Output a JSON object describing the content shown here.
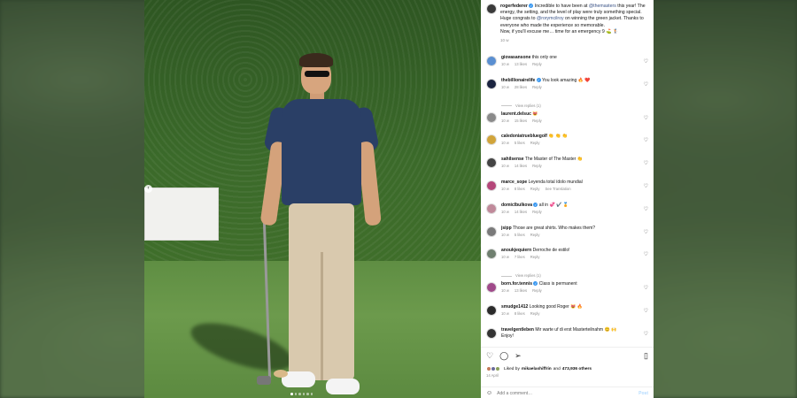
{
  "post": {
    "author": "rogerfederer",
    "caption_parts": {
      "p1": "Incredible to have been at ",
      "mention1": "@themasters",
      "p2": " this year! The energy, the setting, and the level of play were truly something special. Huge congrats to ",
      "mention2": "@rorymcilroy",
      "p3": " on winning the green jacket. Thanks to everyone who made the experience so memorable.",
      "p4": "Now, if you'll excuse me… time for an emergency 9 ⛳️ 🏌️"
    },
    "time": "10 w",
    "photo_dots": 6,
    "photo_active_dot": 0
  },
  "comments": [
    {
      "user": "giovasansone",
      "verified": false,
      "text": "this only one",
      "time": "10 w",
      "likes": "13 likes",
      "reply": "Reply",
      "avatar_color": "#5a8fd1"
    },
    {
      "user": "thebillionairelife",
      "verified": true,
      "text": "You look amazing 🔥 ❤️",
      "time": "10 w",
      "likes": "28 likes",
      "reply": "Reply",
      "avatar_color": "#1b2440",
      "replies": "View replies (1)"
    },
    {
      "user": "laurent.delsuc",
      "verified": false,
      "text": "😻",
      "time": "10 w",
      "likes": "15 likes",
      "reply": "Reply",
      "avatar_color": "#8a8a8a"
    },
    {
      "user": "caledoniatruebluegolf",
      "verified": false,
      "text": "👏 👏 👏",
      "time": "10 w",
      "likes": "5 likes",
      "reply": "Reply",
      "avatar_color": "#d1a43a"
    },
    {
      "user": "sahilsense",
      "verified": false,
      "text": "The Master of The Master 👏",
      "time": "10 w",
      "likes": "14 likes",
      "reply": "Reply",
      "avatar_color": "#444444"
    },
    {
      "user": "marce_sope",
      "verified": false,
      "text": "Leyenda total ídolo mundial",
      "time": "10 w",
      "likes": "8 likes",
      "reply": "Reply",
      "translate": "See Translation",
      "avatar_color": "#b5477a"
    },
    {
      "user": "domiclbulkova",
      "verified": true,
      "text": "all in 💞 ✔️ 🏅",
      "time": "10 w",
      "likes": "14 likes",
      "reply": "Reply",
      "avatar_color": "#c08a9a"
    },
    {
      "user": "jsipp",
      "verified": false,
      "text": "Those are great shirts. Who makes them?",
      "time": "10 w",
      "likes": "5 likes",
      "reply": "Reply",
      "avatar_color": "#7a7a7a"
    },
    {
      "user": "anoukjequiern",
      "verified": false,
      "text": "Derroche de estilo!",
      "time": "10 w",
      "likes": "7 likes",
      "reply": "Reply",
      "avatar_color": "#6f7f6f",
      "replies": "View replies (1)"
    },
    {
      "user": "born.for.tennis",
      "verified": true,
      "text": "Class is permanent",
      "time": "10 w",
      "likes": "13 likes",
      "reply": "Reply",
      "avatar_color": "#a04a8a"
    },
    {
      "user": "smudge1412",
      "verified": false,
      "text": "Looking good Roger 😻 🔥",
      "time": "10 w",
      "likes": "8 likes",
      "reply": "Reply",
      "avatar_color": "#2b2b2b"
    },
    {
      "user": "travelgentleben",
      "verified": false,
      "text": "Mir warte uf di erst Masterteilnahm 😊 🙌",
      "text2": "Enjoy!",
      "time": "",
      "likes": "",
      "reply": "",
      "avatar_color": "#333333"
    }
  ],
  "footer": {
    "liked_by_prefix": "Liked by ",
    "liked_by_user": "mikaelashiffrin",
    "liked_by_and": " and ",
    "liked_by_count": "473,936 others",
    "date": "14 April",
    "add_comment_placeholder": "Add a comment…",
    "post_label": "Post"
  },
  "colors": {
    "verified": "#3897f0",
    "mention": "#385185",
    "post_button": "#b3dbff"
  },
  "icons": [
    "heart-icon",
    "comment-icon",
    "share-icon",
    "bookmark-icon",
    "emoji-icon"
  ]
}
